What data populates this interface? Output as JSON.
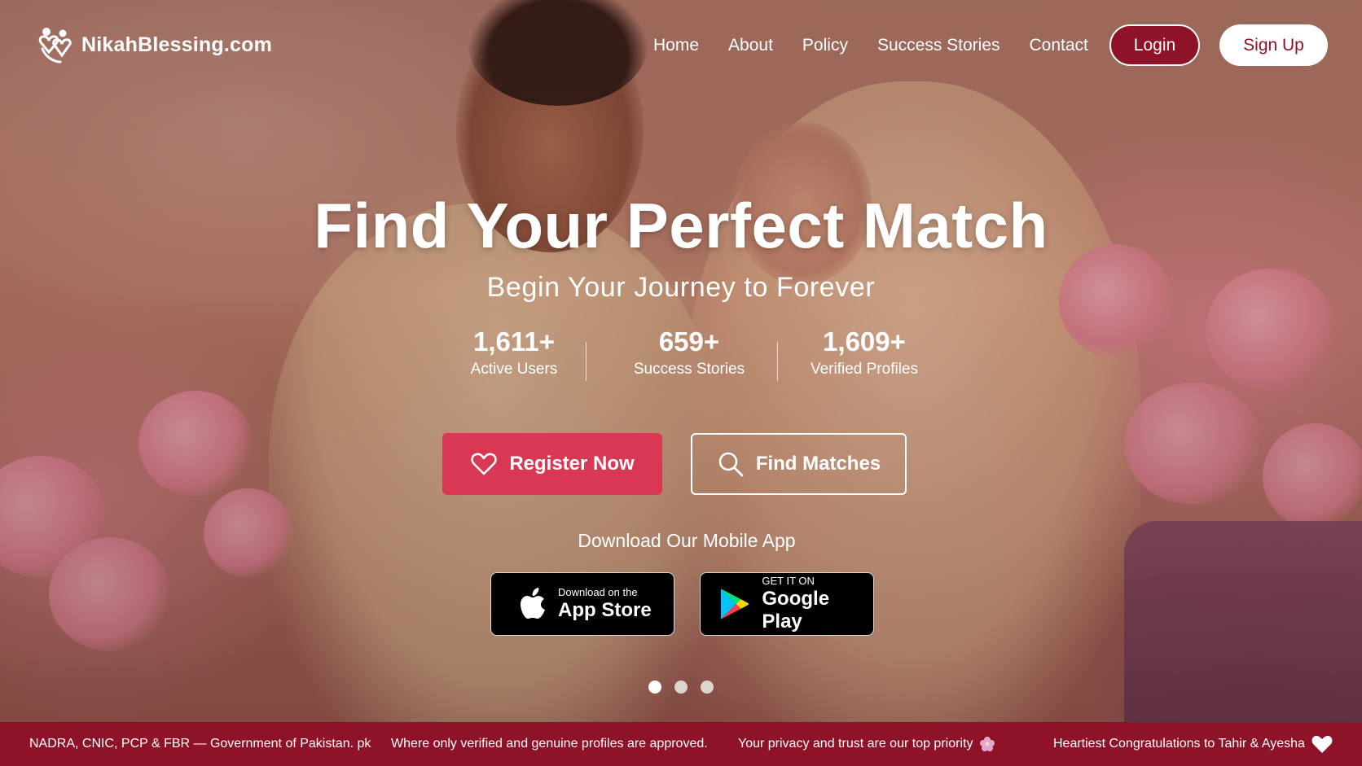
{
  "brand": {
    "name": "NikahBlessing.com",
    "icon": "couple-heart-logo-icon"
  },
  "nav": {
    "items": [
      "Home",
      "About",
      "Policy",
      "Success Stories",
      "Contact"
    ],
    "login_label": "Login",
    "signup_label": "Sign Up"
  },
  "hero": {
    "title": "Find Your Perfect Match",
    "subtitle": "Begin Your Journey to Forever",
    "stats": [
      {
        "value": "1,611+",
        "label": "Active Users"
      },
      {
        "value": "659+",
        "label": "Success Stories"
      },
      {
        "value": "1,609+",
        "label": "Verified Profiles"
      }
    ],
    "register_label": "Register Now",
    "find_label": "Find Matches",
    "app_heading": "Download Our Mobile App",
    "app_store": {
      "small": "Download on the",
      "big": "App Store"
    },
    "google_play": {
      "small": "GET IT ON",
      "big": "Google Play"
    },
    "carousel": {
      "slides": 3,
      "active": 1
    }
  },
  "ticker": {
    "items": [
      "NADRA, CNIC, PCP & FBR — Government of Pakistan. pk",
      "Where only verified and genuine profiles are approved.",
      "Your privacy and trust are our top priority",
      "Heartiest Congratulations to Tahir & Ayesha"
    ]
  },
  "colors": {
    "accent": "#8e1228",
    "cta": "#d93855",
    "white": "#ffffff"
  }
}
